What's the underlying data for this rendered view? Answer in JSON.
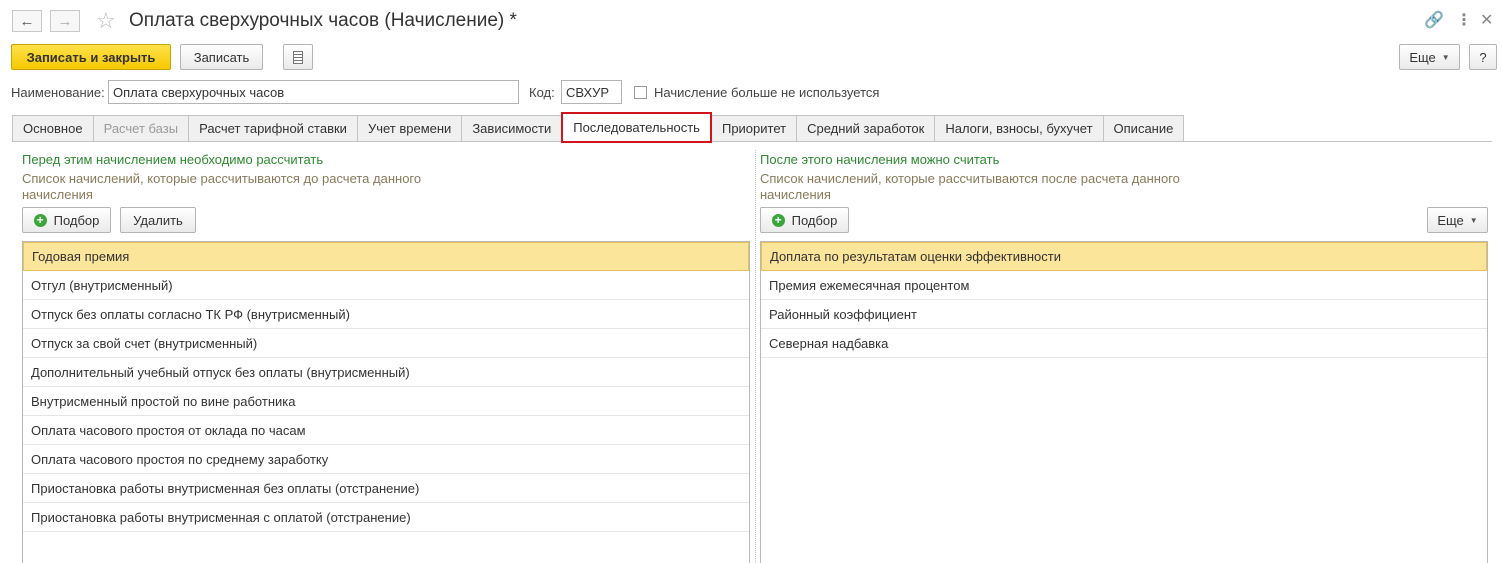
{
  "titlebar": {
    "title": "Оплата сверхурочных часов (Начисление) *",
    "back_icon": "←",
    "forward_icon": "→",
    "star_icon": "☆",
    "link_icon": "🔗",
    "more_icon": "⋮",
    "close_icon": "✕"
  },
  "toolbar": {
    "save_close_label": "Записать и закрыть",
    "save_label": "Записать",
    "more_label": "Еще",
    "help_label": "?"
  },
  "fields": {
    "name_label": "Наименование:",
    "name_value": "Оплата сверхурочных часов",
    "code_label": "Код:",
    "code_value": "СВХУР",
    "unused_label": "Начисление больше не используется"
  },
  "tabs": [
    {
      "label": "Основное"
    },
    {
      "label": "Расчет базы"
    },
    {
      "label": "Расчет тарифной ставки"
    },
    {
      "label": "Учет времени"
    },
    {
      "label": "Зависимости"
    },
    {
      "label": "Последовательность"
    },
    {
      "label": "Приоритет"
    },
    {
      "label": "Средний заработок"
    },
    {
      "label": "Налоги, взносы, бухучет"
    },
    {
      "label": "Описание"
    }
  ],
  "left_panel": {
    "heading": "Перед этим начислением необходимо рассчитать",
    "description": "Список начислений, которые рассчитываются до расчета данного начисления",
    "pick_label": "Подбор",
    "delete_label": "Удалить",
    "items": [
      "Годовая премия",
      "Отгул (внутрисменный)",
      "Отпуск без оплаты согласно ТК РФ (внутрисменный)",
      "Отпуск за свой счет (внутрисменный)",
      "Дополнительный учебный отпуск без оплаты (внутрисменный)",
      "Внутрисменный простой по вине работника",
      "Оплата часового простоя от оклада по часам",
      "Оплата часового простоя по среднему заработку",
      "Приостановка работы внутрисменная без оплаты (отстранение)",
      "Приостановка работы внутрисменная с оплатой (отстранение)"
    ]
  },
  "right_panel": {
    "heading": "После этого начисления можно считать",
    "description": "Список начислений, которые рассчитываются после расчета данного начисления",
    "pick_label": "Подбор",
    "more_label": "Еще",
    "items": [
      "Доплата по результатам оценки эффективности",
      "Премия ежемесячная процентом",
      "Районный коэффициент",
      "Северная надбавка"
    ]
  },
  "colors": {
    "primary_button": "#f5c800",
    "active_tab_border": "#d2151b",
    "heading_green": "#2d8a32",
    "selected_row": "#fbe59a"
  }
}
